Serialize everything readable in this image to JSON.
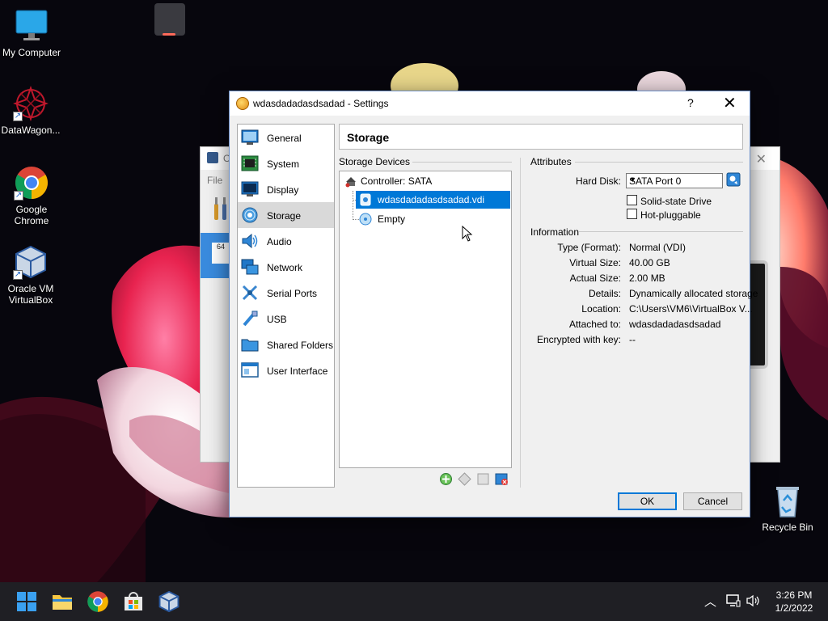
{
  "desktop": {
    "icons": [
      {
        "label": "My Computer",
        "icon": "monitor-icon"
      },
      {
        "label": "DataWagon...",
        "icon": "datawagon-icon"
      },
      {
        "label": "Google Chrome",
        "icon": "chrome-icon"
      },
      {
        "label": "Oracle VM VirtualBox",
        "icon": "virtualbox-icon"
      },
      {
        "label": "Recycle Bin",
        "icon": "recycle-bin-icon"
      }
    ]
  },
  "background_window": {
    "menu_label": "File",
    "title_initial": "O"
  },
  "dialog": {
    "title": "wdasdadadasdsadad - Settings",
    "help_glyph": "?",
    "close_glyph": "✕",
    "nav": [
      {
        "label": "General",
        "icon": "general-icon"
      },
      {
        "label": "System",
        "icon": "system-icon"
      },
      {
        "label": "Display",
        "icon": "display-icon"
      },
      {
        "label": "Storage",
        "icon": "storage-icon",
        "selected": true
      },
      {
        "label": "Audio",
        "icon": "audio-icon"
      },
      {
        "label": "Network",
        "icon": "network-icon"
      },
      {
        "label": "Serial Ports",
        "icon": "serial-ports-icon"
      },
      {
        "label": "USB",
        "icon": "usb-icon"
      },
      {
        "label": "Shared Folders",
        "icon": "shared-folders-icon"
      },
      {
        "label": "User Interface",
        "icon": "user-interface-icon"
      }
    ],
    "page_title": "Storage",
    "storage_devices": {
      "heading": "Storage Devices",
      "controller": "Controller: SATA",
      "items": [
        {
          "label": "wdasdadadasdsadad.vdi",
          "icon": "hard-disk-icon",
          "selected": true
        },
        {
          "label": "Empty",
          "icon": "optical-disc-icon",
          "selected": false
        }
      ],
      "toolbar": [
        "add-controller-icon",
        "remove-controller-icon",
        "add-attachment-icon",
        "remove-attachment-icon"
      ]
    },
    "attributes": {
      "heading": "Attributes",
      "hard_disk_label": "Hard Disk:",
      "hard_disk_value": "SATA Port 0",
      "solid_state_label": "Solid-state Drive",
      "solid_state_checked": false,
      "hot_pluggable_label": "Hot-pluggable",
      "hot_pluggable_checked": false
    },
    "information": {
      "heading": "Information",
      "rows": [
        {
          "label": "Type (Format):",
          "value": "Normal (VDI)"
        },
        {
          "label": "Virtual Size:",
          "value": "40.00 GB"
        },
        {
          "label": "Actual Size:",
          "value": "2.00 MB"
        },
        {
          "label": "Details:",
          "value": "Dynamically allocated storage"
        },
        {
          "label": "Location:",
          "value": "C:\\Users\\VM6\\VirtualBox V..."
        },
        {
          "label": "Attached to:",
          "value": "wdasdadadasdsadad"
        },
        {
          "label": "Encrypted with key:",
          "value": "--"
        }
      ]
    },
    "buttons": {
      "ok": "OK",
      "cancel": "Cancel"
    }
  },
  "taskbar": {
    "apps": [
      "start-icon",
      "file-explorer-icon",
      "chrome-icon",
      "store-icon",
      "virtualbox-icon"
    ],
    "active_app": "virtualbox-icon",
    "tray": [
      "chevron-up-icon",
      "network-icon",
      "volume-icon"
    ],
    "time": "3:26 PM",
    "date": "1/2/2022"
  }
}
